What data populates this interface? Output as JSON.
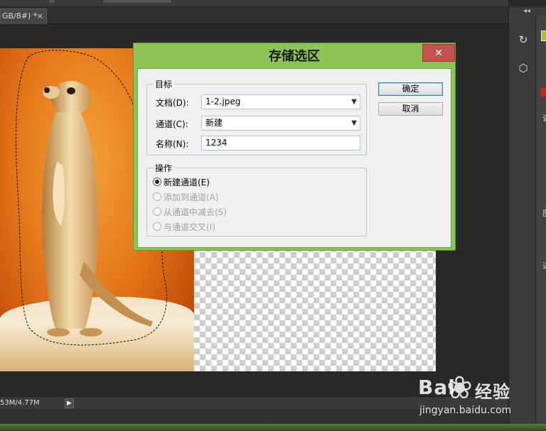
{
  "document_tab": {
    "label": "GB/8#) *",
    "close_glyph": "×"
  },
  "status": {
    "doc_size": "53M/4.77M",
    "arrow": "▶"
  },
  "right_panel": {
    "collapse_glyph": "◂◂",
    "chars": [
      "调",
      "图",
      "进"
    ]
  },
  "dialog": {
    "title": "存储选区",
    "close_glyph": "✕",
    "target_group": {
      "legend": "目标",
      "document_label": "文档(D):",
      "document_value": "1-2.jpeg",
      "channel_label": "通道(C):",
      "channel_value": "新建",
      "name_label": "名称(N):",
      "name_value": "1234"
    },
    "operation_group": {
      "legend": "操作",
      "options": [
        {
          "label": "新建通道(E)",
          "checked": true,
          "enabled": true
        },
        {
          "label": "添加到通道(A)",
          "checked": false,
          "enabled": false
        },
        {
          "label": "从通道中减去(S)",
          "checked": false,
          "enabled": false
        },
        {
          "label": "与通道交叉(I)",
          "checked": false,
          "enabled": false
        }
      ]
    },
    "ok_label": "确定",
    "cancel_label": "取消"
  },
  "watermark": {
    "brand": "Bai",
    "brand_suffix": "经验",
    "url": "jingyan.baidu.com"
  },
  "colors": {
    "dialog_frame": "#8dc45a",
    "close_button": "#c75050",
    "swatch": "#a9c41a"
  }
}
